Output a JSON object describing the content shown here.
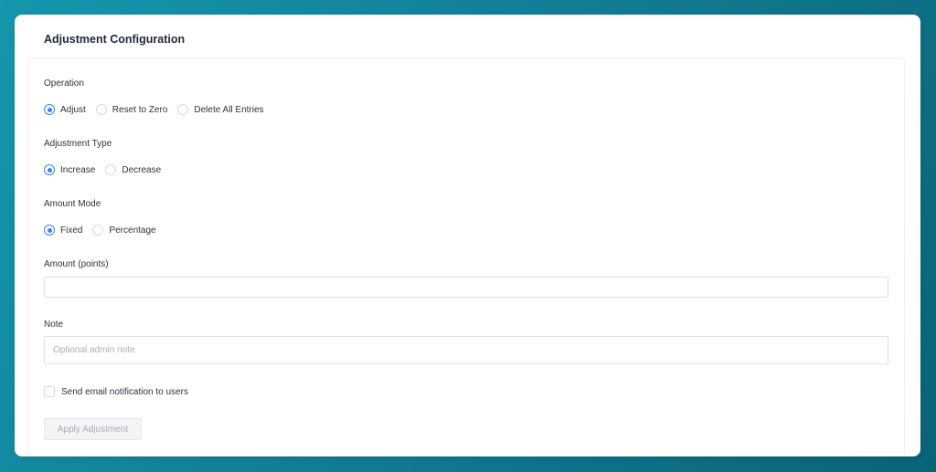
{
  "card": {
    "title": "Adjustment Configuration"
  },
  "operation": {
    "label": "Operation",
    "options": [
      "Adjust",
      "Reset to Zero",
      "Delete All Entries"
    ],
    "selected": "Adjust"
  },
  "adjustment_type": {
    "label": "Adjustment Type",
    "options": [
      "Increase",
      "Decrease"
    ],
    "selected": "Increase"
  },
  "amount_mode": {
    "label": "Amount Mode",
    "options": [
      "Fixed",
      "Percentage"
    ],
    "selected": "Fixed"
  },
  "amount": {
    "label": "Amount (points)",
    "value": "",
    "placeholder": ""
  },
  "note": {
    "label": "Note",
    "value": "",
    "placeholder": "Optional admin note"
  },
  "notify": {
    "label": "Send email notification to users",
    "checked": false
  },
  "submit": {
    "label": "Apply Adjustment",
    "disabled": true
  },
  "colors": {
    "accent": "#3b82f6",
    "background_start": "#1597ad",
    "background_end": "#0a6478"
  }
}
